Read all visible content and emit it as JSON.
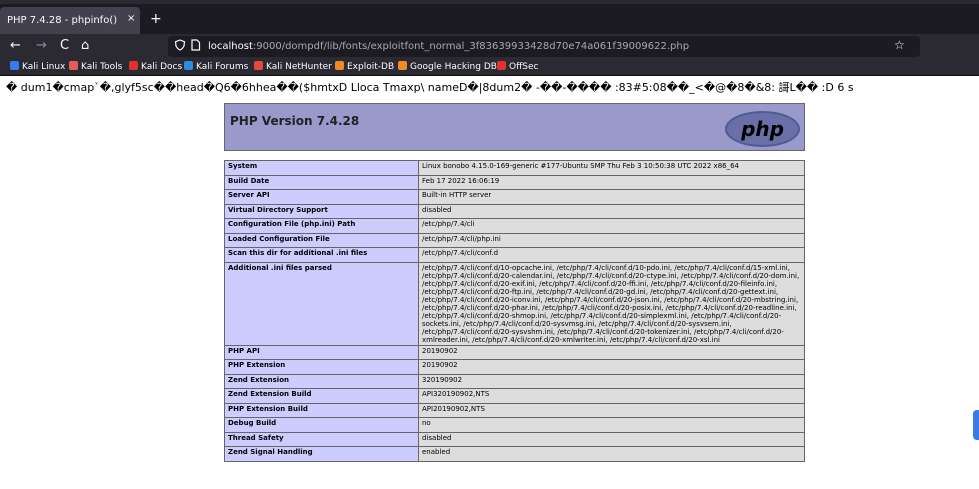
{
  "browser": {
    "tab_title": "PHP 7.4.28 - phpinfo()",
    "tab_close": "×",
    "new_tab": "+",
    "back": "←",
    "forward": "→",
    "reload": "C",
    "home": "⌂",
    "url_host": "localhost",
    "url_rest": ":9000/dompdf/lib/fonts/exploitfont_normal_3f83639933428d70e74a061f39009622.php",
    "bookmark_star": "☆",
    "bookmarks": [
      {
        "label": "Kali Linux",
        "color": "#367bf0"
      },
      {
        "label": "Kali Tools",
        "color": "#e85b5b"
      },
      {
        "label": "Kali Docs",
        "color": "#e0312f"
      },
      {
        "label": "Kali Forums",
        "color": "#2f8cd8"
      },
      {
        "label": "Kali NetHunter",
        "color": "#e5483f"
      },
      {
        "label": "Exploit-DB",
        "color": "#f08a24"
      },
      {
        "label": "Google Hacking DB",
        "color": "#f08a24"
      },
      {
        "label": "OffSec",
        "color": "#e0312f"
      }
    ]
  },
  "garbled_text": "� dum1�cmap`�,glyf5sc��head�Q6�6hhea��($hmtxD Lloca Tmaxp\\ nameD�|8dum2� -��-���� :83#5:08��_<�@�8�&8: 謌L�� :D 6   s",
  "php": {
    "version_title": "PHP Version 7.4.28",
    "logo_text": "php",
    "rows": [
      {
        "label": "System",
        "value": "Linux bonobo 4.15.0-169-generic #177-Ubuntu SMP Thu Feb 3 10:50:38 UTC 2022 x86_64"
      },
      {
        "label": "Build Date",
        "value": "Feb 17 2022 16:06:19"
      },
      {
        "label": "Server API",
        "value": "Built-in HTTP server"
      },
      {
        "label": "Virtual Directory Support",
        "value": "disabled"
      },
      {
        "label": "Configuration File (php.ini) Path",
        "value": "/etc/php/7.4/cli"
      },
      {
        "label": "Loaded Configuration File",
        "value": "/etc/php/7.4/cli/php.ini"
      },
      {
        "label": "Scan this dir for additional .ini files",
        "value": "/etc/php/7.4/cli/conf.d"
      },
      {
        "label": "Additional .ini files parsed",
        "value": "/etc/php/7.4/cli/conf.d/10-opcache.ini, /etc/php/7.4/cli/conf.d/10-pdo.ini, /etc/php/7.4/cli/conf.d/15-xml.ini, /etc/php/7.4/cli/conf.d/20-calendar.ini, /etc/php/7.4/cli/conf.d/20-ctype.ini, /etc/php/7.4/cli/conf.d/20-dom.ini, /etc/php/7.4/cli/conf.d/20-exif.ini, /etc/php/7.4/cli/conf.d/20-ffi.ini, /etc/php/7.4/cli/conf.d/20-fileinfo.ini, /etc/php/7.4/cli/conf.d/20-ftp.ini, /etc/php/7.4/cli/conf.d/20-gd.ini, /etc/php/7.4/cli/conf.d/20-gettext.ini, /etc/php/7.4/cli/conf.d/20-iconv.ini, /etc/php/7.4/cli/conf.d/20-json.ini, /etc/php/7.4/cli/conf.d/20-mbstring.ini, /etc/php/7.4/cli/conf.d/20-phar.ini, /etc/php/7.4/cli/conf.d/20-posix.ini, /etc/php/7.4/cli/conf.d/20-readline.ini, /etc/php/7.4/cli/conf.d/20-shmop.ini, /etc/php/7.4/cli/conf.d/20-simplexml.ini, /etc/php/7.4/cli/conf.d/20-sockets.ini, /etc/php/7.4/cli/conf.d/20-sysvmsg.ini, /etc/php/7.4/cli/conf.d/20-sysvsem.ini, /etc/php/7.4/cli/conf.d/20-sysvshm.ini, /etc/php/7.4/cli/conf.d/20-tokenizer.ini, /etc/php/7.4/cli/conf.d/20-xmlreader.ini, /etc/php/7.4/cli/conf.d/20-xmlwriter.ini, /etc/php/7.4/cli/conf.d/20-xsl.ini"
      },
      {
        "label": "PHP API",
        "value": "20190902"
      },
      {
        "label": "PHP Extension",
        "value": "20190902"
      },
      {
        "label": "Zend Extension",
        "value": "320190902"
      },
      {
        "label": "Zend Extension Build",
        "value": "API320190902,NTS"
      },
      {
        "label": "PHP Extension Build",
        "value": "API20190902,NTS"
      },
      {
        "label": "Debug Build",
        "value": "no"
      },
      {
        "label": "Thread Safety",
        "value": "disabled"
      },
      {
        "label": "Zend Signal Handling",
        "value": "enabled"
      }
    ]
  }
}
